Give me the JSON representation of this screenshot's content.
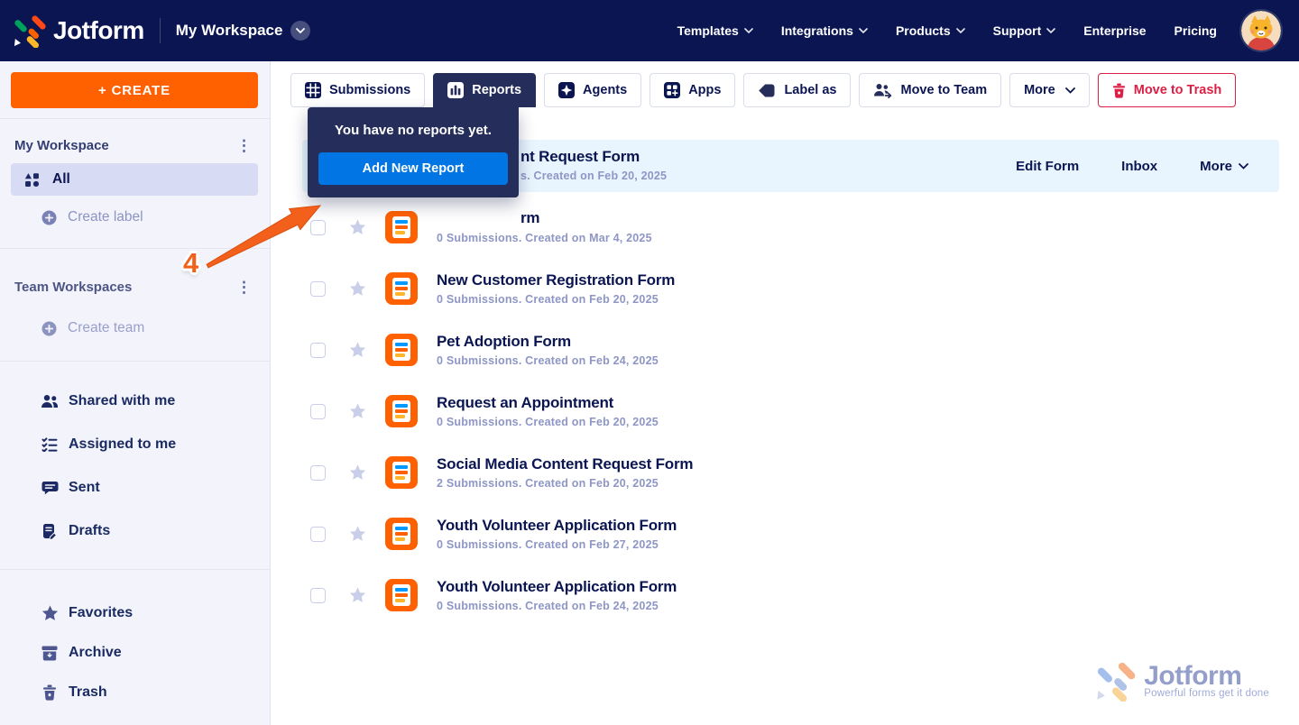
{
  "navbar": {
    "brand": "Jotform",
    "workspace_switcher": "My Workspace",
    "menu": [
      {
        "label": "Templates",
        "dropdown": true
      },
      {
        "label": "Integrations",
        "dropdown": true
      },
      {
        "label": "Products",
        "dropdown": true
      },
      {
        "label": "Support",
        "dropdown": true
      },
      {
        "label": "Enterprise",
        "dropdown": false
      },
      {
        "label": "Pricing",
        "dropdown": false
      }
    ]
  },
  "sidebar": {
    "create_button": "+ CREATE",
    "my_workspace": {
      "label": "My Workspace"
    },
    "all_item": {
      "label": "All",
      "selected": true
    },
    "create_label": "Create label",
    "team_workspaces": {
      "label": "Team Workspaces"
    },
    "create_team": "Create team",
    "nav_items": [
      {
        "label": "Shared with me"
      },
      {
        "label": "Assigned to me"
      },
      {
        "label": "Sent"
      },
      {
        "label": "Drafts"
      }
    ],
    "bottom_items": [
      {
        "label": "Favorites"
      },
      {
        "label": "Archive"
      },
      {
        "label": "Trash"
      }
    ]
  },
  "toolbar": {
    "buttons": [
      {
        "label": "Submissions",
        "state": "default"
      },
      {
        "label": "Reports",
        "state": "active"
      },
      {
        "label": "Agents",
        "state": "default"
      },
      {
        "label": "Apps",
        "state": "default"
      },
      {
        "label": "Label as",
        "state": "default"
      },
      {
        "label": "Move to Team",
        "state": "default"
      },
      {
        "label": "More",
        "state": "default",
        "dropdown": true
      },
      {
        "label": "Move to Trash",
        "state": "danger"
      }
    ]
  },
  "popover": {
    "message": "You have no reports yet.",
    "button_label": "Add New Report"
  },
  "annotation": {
    "step_number": "4"
  },
  "rows": [
    {
      "title": "nt Request Form",
      "subtitle": "s. Created on Feb 20, 2025",
      "highlighted": true,
      "partially_covered": true,
      "actions": {
        "edit": "Edit Form",
        "inbox": "Inbox",
        "more": "More"
      }
    },
    {
      "title": "rm",
      "subtitle": "0 Submissions. Created on Mar 4, 2025",
      "partially_covered": true
    },
    {
      "title": "New Customer Registration Form",
      "subtitle": "0 Submissions. Created on Feb 20, 2025"
    },
    {
      "title": "Pet Adoption Form",
      "subtitle": "0 Submissions. Created on Feb 24, 2025"
    },
    {
      "title": "Request an Appointment",
      "subtitle": "0 Submissions. Created on Feb 20, 2025"
    },
    {
      "title": "Social Media Content Request Form",
      "subtitle": "2 Submissions. Created on Feb 20, 2025"
    },
    {
      "title": "Youth Volunteer Application Form",
      "subtitle": "0 Submissions. Created on Feb 27, 2025"
    },
    {
      "title": "Youth Volunteer Application Form",
      "subtitle": "0 Submissions. Created on Feb 24, 2025"
    }
  ],
  "watermark": {
    "brand": "Jotform",
    "tagline": "Powerful forms get it done"
  },
  "colors": {
    "brand_navy": "#0a1551",
    "panel_navy": "#252d5b",
    "accent_orange": "#ff6100",
    "annotation_orange": "#f2601c",
    "primary_blue": "#0075e3",
    "danger_red": "#dc2045",
    "row_highlight": "#e9f5fe",
    "sidebar_bg": "#f3f4fb",
    "selected_item_bg": "#d7dbf3",
    "muted_text": "#8e96c6"
  }
}
